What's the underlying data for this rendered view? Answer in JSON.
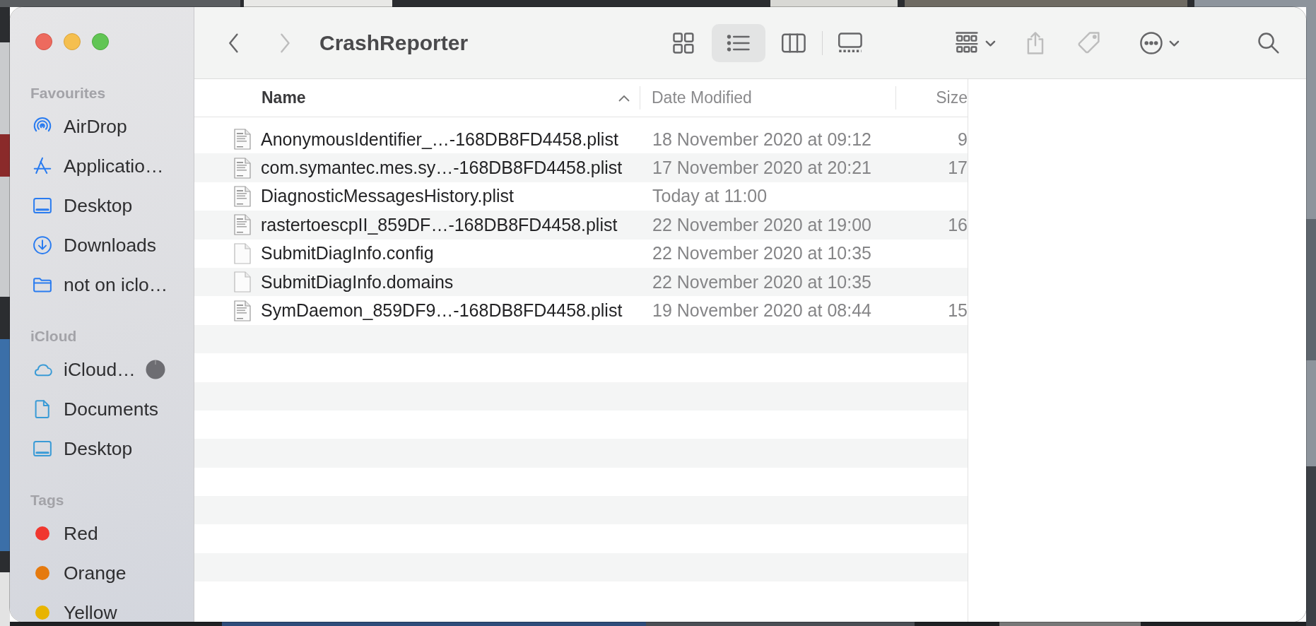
{
  "window": {
    "title": "CrashReporter"
  },
  "toolbar": {
    "nav": [
      {
        "kind": "back",
        "disabled": false
      },
      {
        "kind": "forward",
        "disabled": true
      }
    ],
    "views": [
      {
        "kind": "icons",
        "selected": false
      },
      {
        "kind": "list",
        "selected": true
      },
      {
        "kind": "columns",
        "selected": false
      },
      {
        "kind": "gallery",
        "selected": false
      }
    ],
    "actions": [
      {
        "kind": "group",
        "disabled": false
      },
      {
        "kind": "share",
        "disabled": true
      },
      {
        "kind": "tags",
        "disabled": true
      },
      {
        "kind": "more",
        "disabled": false
      },
      {
        "kind": "search",
        "disabled": false
      }
    ]
  },
  "sidebar": {
    "sections": [
      {
        "heading": "Favourites",
        "items": [
          {
            "label": "AirDrop",
            "kind": "airdrop"
          },
          {
            "label": "Applicatio…",
            "kind": "apps"
          },
          {
            "label": "Desktop",
            "kind": "desktop"
          },
          {
            "label": "Downloads",
            "kind": "downloads"
          },
          {
            "label": "not on iclo…",
            "kind": "folder"
          }
        ]
      },
      {
        "heading": "iCloud",
        "items": [
          {
            "label": "iCloud…",
            "kind": "cloud",
            "syncing": true
          },
          {
            "label": "Documents",
            "kind": "document",
            "syncing": false
          },
          {
            "label": "Desktop",
            "kind": "desktop",
            "syncing": false
          }
        ]
      },
      {
        "heading": "Tags",
        "items": [
          {
            "label": "Red",
            "kind": "tag",
            "color": "#f0372f"
          },
          {
            "label": "Orange",
            "kind": "tag",
            "color": "#e57a0e"
          },
          {
            "label": "Yellow",
            "kind": "tag",
            "color": "#e8b400"
          }
        ]
      }
    ]
  },
  "table": {
    "columns": [
      {
        "label": "Name",
        "sorted": true
      },
      {
        "label": "Date Modified",
        "sorted": false
      },
      {
        "label": "Size",
        "sorted": false
      }
    ],
    "rows": [
      {
        "kind": "plist",
        "name": "AnonymousIdentifier_…-168DB8FD4458.plist",
        "date": "18 November 2020 at 09:12",
        "size": "9"
      },
      {
        "kind": "plist",
        "name": "com.symantec.mes.sy…-168DB8FD4458.plist",
        "date": "17 November 2020 at 20:21",
        "size": "17"
      },
      {
        "kind": "plist",
        "name": "DiagnosticMessagesHistory.plist",
        "date": "Today at 11:00"
      },
      {
        "kind": "plist",
        "name": "rastertoescpII_859DF…-168DB8FD4458.plist",
        "date": "22 November 2020 at 19:00",
        "size": "16"
      },
      {
        "kind": "document",
        "name": "SubmitDiagInfo.config",
        "date": "22 November 2020 at 10:35"
      },
      {
        "kind": "document",
        "name": "SubmitDiagInfo.domains",
        "date": "22 November 2020 at 10:35"
      },
      {
        "kind": "plist",
        "name": "SymDaemon_859DF9…-168DB8FD4458.plist",
        "date": "19 November 2020 at 08:44",
        "size": "15"
      }
    ]
  }
}
